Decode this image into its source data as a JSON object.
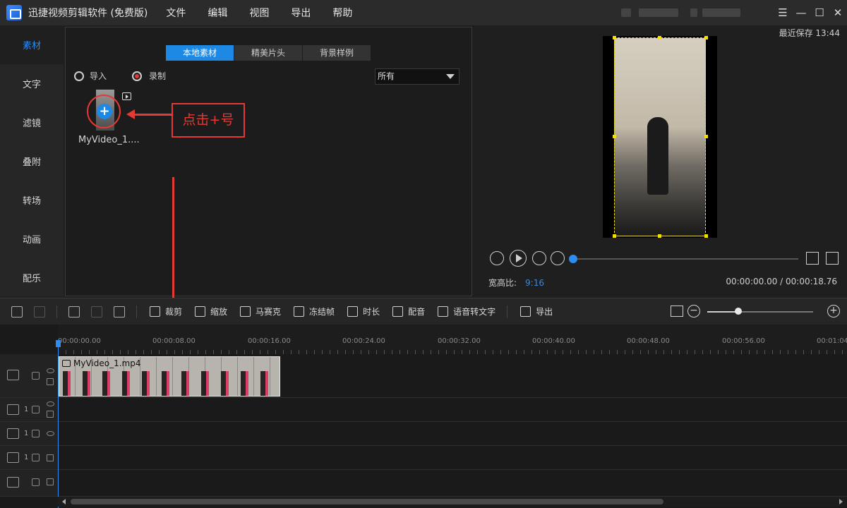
{
  "titlebar": {
    "app_title": "迅捷视频剪辑软件 (免费版)",
    "menu": [
      "文件",
      "编辑",
      "视图",
      "导出",
      "帮助"
    ],
    "window_controls": [
      "☰",
      "—",
      "☐",
      "✕"
    ]
  },
  "sidebar": {
    "items": [
      "素材",
      "文字",
      "滤镜",
      "叠附",
      "转场",
      "动画",
      "配乐"
    ],
    "active_index": 0
  },
  "media": {
    "tabs": [
      "本地素材",
      "精美片头",
      "背景样例"
    ],
    "active_tab": 0,
    "import_label": "导入",
    "record_label": "录制",
    "filter_value": "所有",
    "items": [
      {
        "name": "MyVideo_1...."
      }
    ],
    "plus_symbol": "+",
    "annotation_text": "点击+号",
    "accent_color": "#1e88e5",
    "annotation_color": "#e53935"
  },
  "preview": {
    "save_time": "最近保存 13:44",
    "aspect_label": "宽高比:",
    "aspect_value": "9:16",
    "timecode": "00:00:00.00 / 00:00:18.76",
    "progress_fraction": 0.0
  },
  "toolbar": {
    "items": [
      "裁剪",
      "缩放",
      "马赛克",
      "冻结帧",
      "时长",
      "配音",
      "语音转文字",
      "导出"
    ],
    "zoom_fraction": 0.29
  },
  "timeline": {
    "ruler_labels": [
      "00:00:00.00",
      "00:00:08.00",
      "00:00:16.00",
      "00:00:24.00",
      "00:00:32.00",
      "00:00:40.00",
      "00:00:48.00",
      "00:00:56.00",
      "00:01:04"
    ],
    "clip_name": "MyVideo_1.mp4",
    "track_numbers": [
      "1",
      "1",
      "1"
    ]
  }
}
